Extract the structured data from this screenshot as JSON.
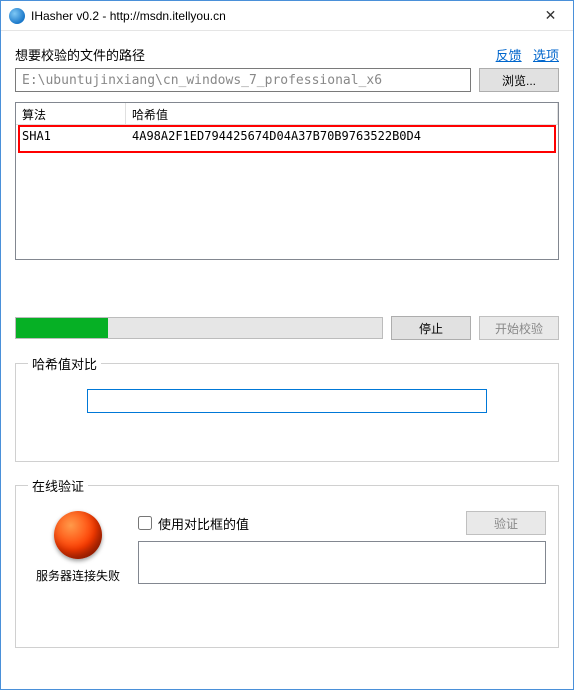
{
  "window": {
    "title": "IHasher v0.2 - http://msdn.itellyou.cn"
  },
  "links": {
    "feedback": "反馈",
    "options": "选项"
  },
  "path": {
    "label": "想要校验的文件的路径",
    "value": "E:\\ubuntujinxiang\\cn_windows_7_professional_x6",
    "browse": "浏览..."
  },
  "table": {
    "headers": {
      "algo": "算法",
      "hash": "哈希值"
    },
    "rows": [
      {
        "algo": "SHA1",
        "hash": "4A98A2F1ED794425674D04A37B70B9763522B0D4"
      }
    ]
  },
  "progress": {
    "percent": 25,
    "stop": "停止",
    "start": "开始校验"
  },
  "compare": {
    "legend": "哈希值对比",
    "value": ""
  },
  "verify": {
    "legend": "在线验证",
    "use_compare_checkbox": "使用对比框的值",
    "verify_btn": "验证",
    "status_text": "服务器连接失败",
    "textarea_value": ""
  }
}
